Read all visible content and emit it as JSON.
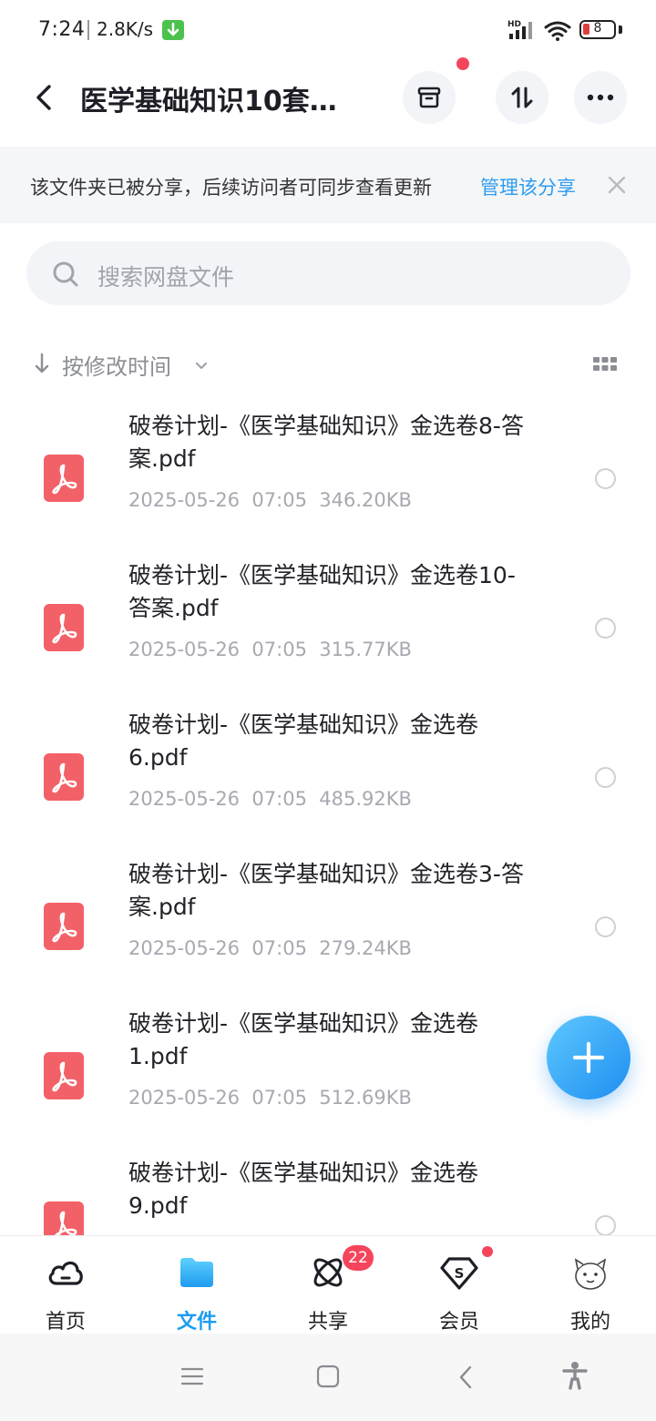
{
  "status_bar": {
    "time": "7:24",
    "speed": "2.8K/s",
    "network": "HD",
    "battery": "8"
  },
  "header": {
    "title": "医学基础知识10套…"
  },
  "share_banner": {
    "text": "该文件夹已被分享，后续访问者可同步查看更新",
    "link": "管理该分享"
  },
  "search": {
    "placeholder": "搜索网盘文件"
  },
  "sort": {
    "label": "按修改时间"
  },
  "files": [
    {
      "name": "破卷计划-《医学基础知识》金选卷8-答案.pdf",
      "date": "2025-05-26",
      "time": "07:05",
      "size": "346.20KB"
    },
    {
      "name": "破卷计划-《医学基础知识》金选卷10-答案.pdf",
      "date": "2025-05-26",
      "time": "07:05",
      "size": "315.77KB"
    },
    {
      "name": "破卷计划-《医学基础知识》金选卷6.pdf",
      "date": "2025-05-26",
      "time": "07:05",
      "size": "485.92KB"
    },
    {
      "name": "破卷计划-《医学基础知识》金选卷3-答案.pdf",
      "date": "2025-05-26",
      "time": "07:05",
      "size": "279.24KB"
    },
    {
      "name": "破卷计划-《医学基础知识》金选卷1.pdf",
      "date": "2025-05-26",
      "time": "07:05",
      "size": "512.69KB"
    },
    {
      "name": "破卷计划-《医学基础知识》金选卷9.pdf",
      "date": "",
      "time": "",
      "size": ""
    }
  ],
  "tabs": [
    {
      "label": "首页",
      "icon": "home-cloud-icon"
    },
    {
      "label": "文件",
      "icon": "folder-icon",
      "active": true
    },
    {
      "label": "共享",
      "icon": "share-atom-icon",
      "badge": "22"
    },
    {
      "label": "会员",
      "icon": "vip-diamond-icon"
    },
    {
      "label": "我的",
      "icon": "avatar-icon"
    }
  ],
  "colors": {
    "accent": "#1c9cf0",
    "link": "#2d9cf0",
    "badge": "#f5455c",
    "pdf": "#f36168"
  }
}
